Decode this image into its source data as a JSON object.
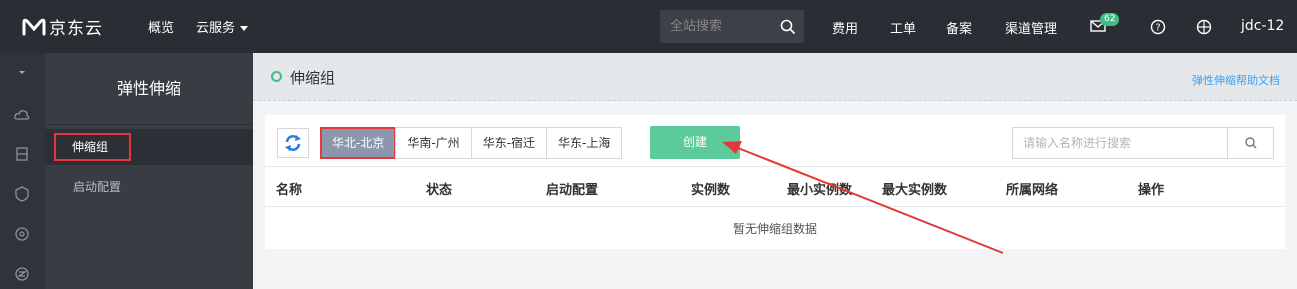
{
  "topbar": {
    "brand": "京东云",
    "nav": [
      "概览",
      "云服务"
    ],
    "search_placeholder": "全站搜索",
    "links": [
      "费用",
      "工单",
      "备案",
      "渠道管理"
    ],
    "mail_badge": "62",
    "user": "jdc-12",
    "icons": [
      "logo-icon",
      "search-icon",
      "mail-icon",
      "help-icon",
      "globe-icon"
    ]
  },
  "rail": {
    "icons": [
      "chevron-down-icon",
      "cloud-icon",
      "server-icon",
      "shield-icon",
      "settings-icon",
      "network-icon"
    ]
  },
  "sidebar": {
    "title": "弹性伸缩",
    "items": [
      {
        "label": "伸缩组",
        "active": true
      },
      {
        "label": "启动配置",
        "active": false
      }
    ]
  },
  "main": {
    "title": "伸缩组",
    "help_link": "弹性伸缩帮助文档",
    "regions": [
      {
        "label": "华北-北京",
        "active": true
      },
      {
        "label": "华南-广州",
        "active": false
      },
      {
        "label": "华东-宿迁",
        "active": false
      },
      {
        "label": "华东-上海",
        "active": false
      }
    ],
    "create_label": "创建",
    "search_placeholder": "请输入名称进行搜索",
    "columns": [
      "名称",
      "状态",
      "启动配置",
      "实例数",
      "最小实例数",
      "最大实例数",
      "所属网络",
      "操作"
    ],
    "empty_text": "暂无伸缩组数据"
  },
  "colors": {
    "topbar_bg": "#2a2d33",
    "accent_green": "#5ccb9c",
    "active_tab_bg": "#8c96ad",
    "highlight_red": "#e23a3a",
    "link_blue": "#3b9ff3"
  }
}
